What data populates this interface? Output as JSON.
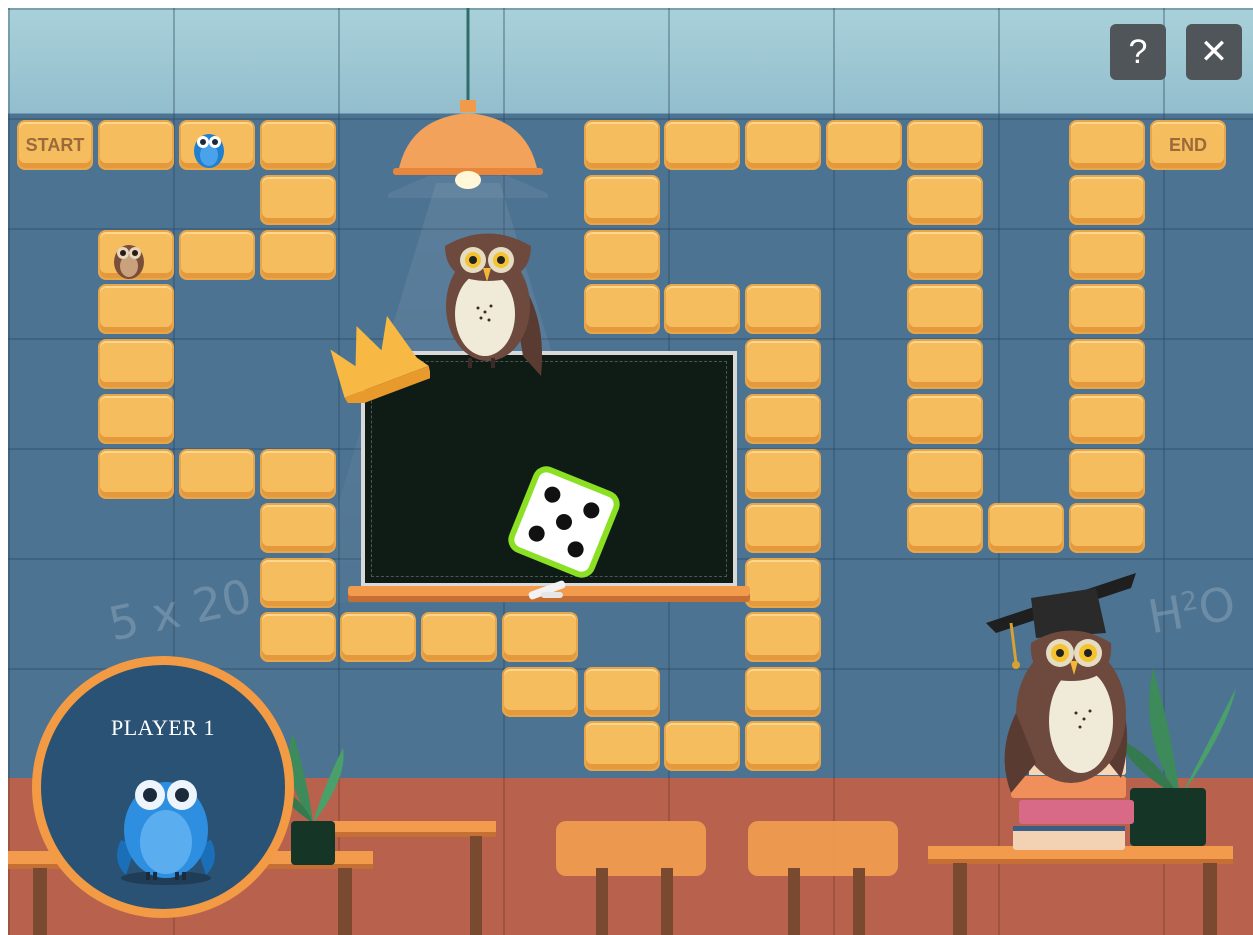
{
  "game": {
    "board": {
      "start_label": "START",
      "end_label": "END"
    },
    "controls": {
      "help_label": "?",
      "close_label": "✕"
    },
    "dice": {
      "value": 5
    },
    "player_card": {
      "label": "PLAYER 1"
    },
    "chalk_writing": {
      "math": "5 x 20",
      "formula_base": "H",
      "formula_sup": "2",
      "formula_end": "O"
    }
  }
}
